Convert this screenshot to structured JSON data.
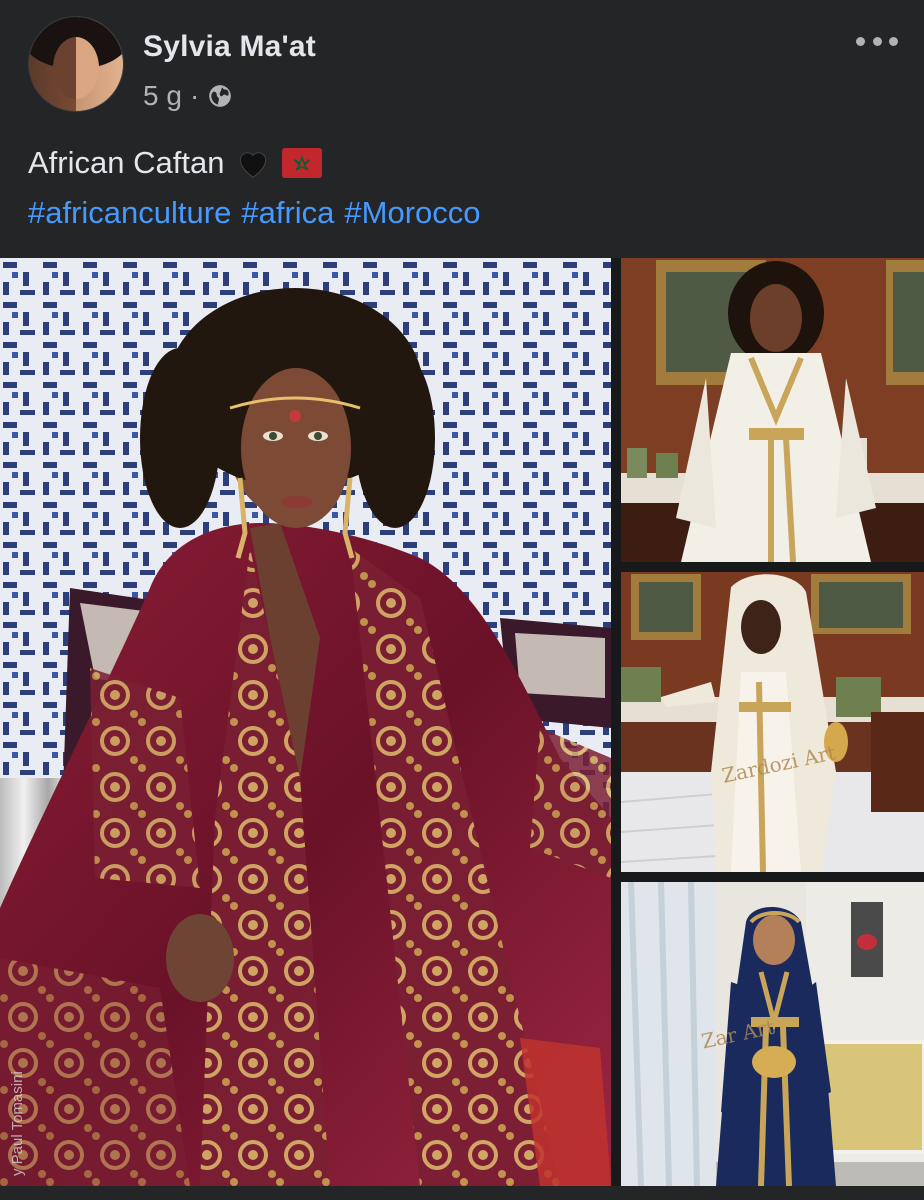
{
  "post": {
    "author": "Sylvia Ma'at",
    "time": "5 g",
    "separator": "·",
    "caption": "African Caftan",
    "hashtags": [
      "#africanculture",
      "#africa",
      "#Morocco"
    ]
  },
  "photos": {
    "main_watermark": "y Paul Tomasini",
    "photo2_watermark": "Zardozi Art",
    "photo3_watermark": "Zar Art"
  },
  "icons": {
    "more": "more-options-icon",
    "audience": "globe-icon",
    "heart": "black-heart-icon",
    "flag": "morocco-flag-icon"
  },
  "colors": {
    "background": "#242526",
    "text_primary": "#e4e6eb",
    "text_secondary": "#b0b3b8",
    "link": "#4599ff"
  }
}
